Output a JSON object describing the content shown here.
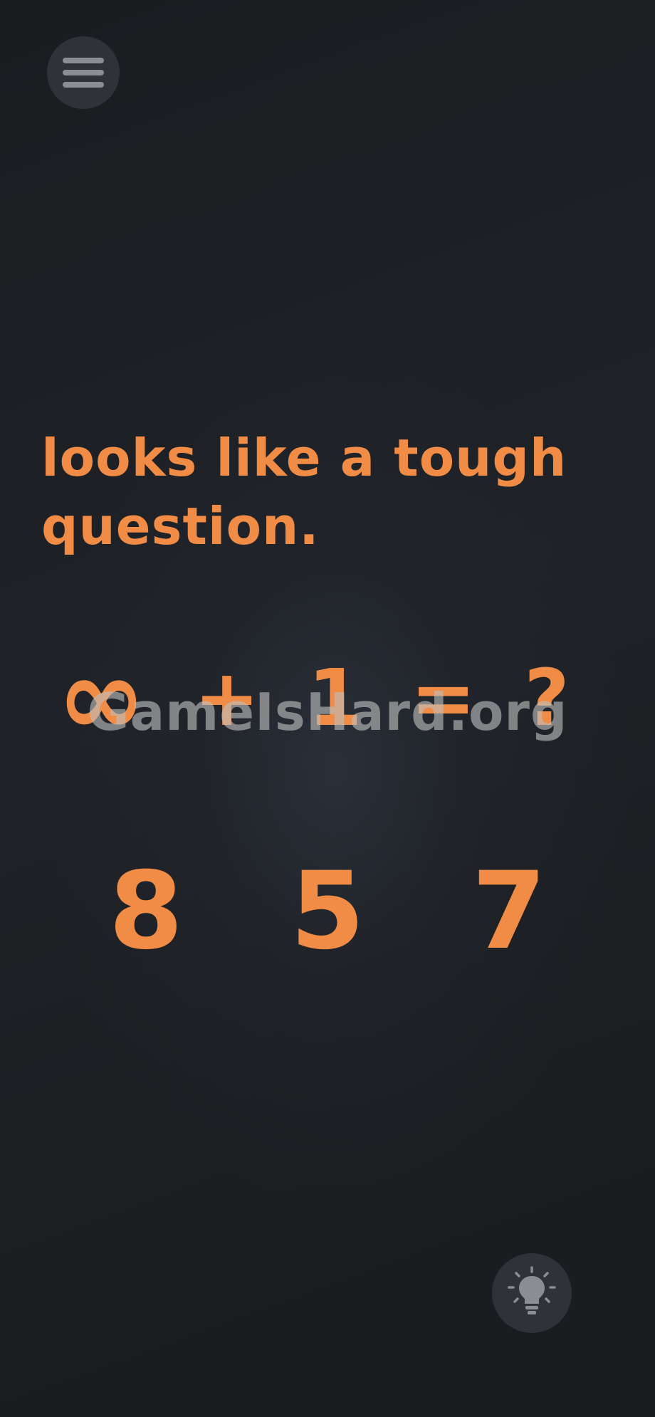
{
  "menu": {
    "icon": "hamburger-menu-icon"
  },
  "question": {
    "line1": "looks like a tough",
    "line2": "question."
  },
  "equation": {
    "operand": "∞",
    "plus": "+",
    "one": "1",
    "equals": "=",
    "unknown": "?"
  },
  "watermark": "GameIsHard.org",
  "answers": [
    "8",
    "5",
    "7"
  ],
  "hint": {
    "icon": "lightbulb-icon"
  },
  "colors": {
    "accent": "#f08c45",
    "background": "#1b1d21",
    "button": "#2f3239",
    "icon": "#8a8d94"
  }
}
